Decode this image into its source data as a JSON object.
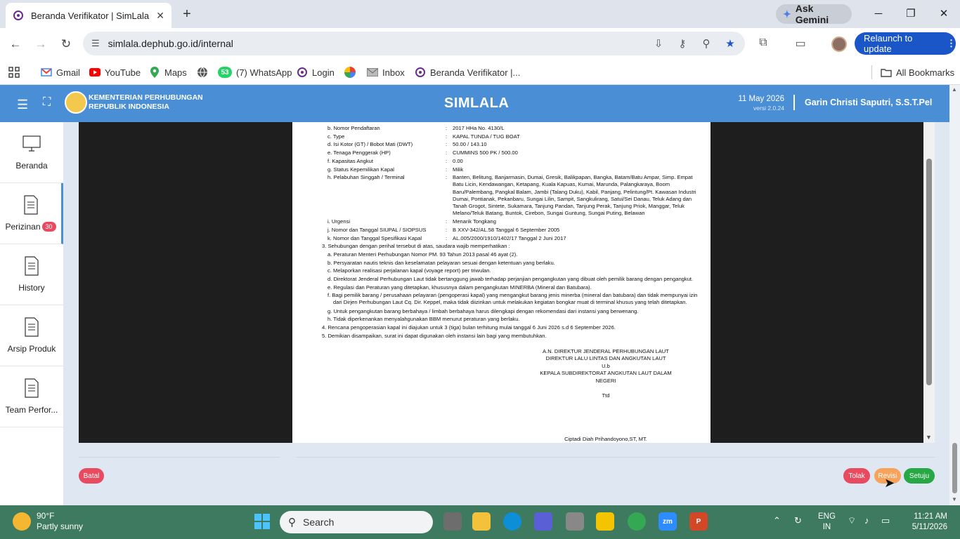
{
  "browser": {
    "tab_title": "Beranda Verifikator | SimLala",
    "new_tab": "+",
    "close_tab": "✕",
    "ask_gemini": "Ask Gemini",
    "url": "simlala.dephub.go.id/internal",
    "relaunch": "Relaunch to update",
    "bookmarks": [
      {
        "label": "Gmail",
        "color": "#ea4335"
      },
      {
        "label": "YouTube",
        "color": "#ff0000"
      },
      {
        "label": "Maps",
        "color": "#34a853"
      },
      {
        "label": "",
        "color": "#555555"
      },
      {
        "label": "(7) WhatsApp",
        "color": "#25d366",
        "badge": "53"
      },
      {
        "label": "Login",
        "color": "#6b2d8c"
      },
      {
        "label": "",
        "color": "#f4b400"
      },
      {
        "label": "Inbox",
        "color": "#888888"
      },
      {
        "label": "Beranda Verifikator |...",
        "color": "#6b2d8c"
      }
    ],
    "all_bookmarks": "All Bookmarks"
  },
  "app": {
    "ministry_line1": "KEMENTERIAN PERHUBUNGAN",
    "ministry_line2": "REPUBLIK INDONESIA",
    "name": "SIMLALA",
    "date": "11 May 2026",
    "version": "versi 2.0.24",
    "user": "Garin Christi Saputri, S.S.T.Pel",
    "accent": "#4a8fd6"
  },
  "sidebar": [
    {
      "label": "Beranda",
      "icon": "monitor-icon"
    },
    {
      "label": "Perizinan",
      "icon": "document-icon",
      "badge": "30",
      "active": true
    },
    {
      "label": "History",
      "icon": "document-icon"
    },
    {
      "label": "Arsip Produk",
      "icon": "document-icon"
    },
    {
      "label": "Team Perfor...",
      "icon": "document-icon"
    }
  ],
  "document": {
    "fields": [
      {
        "key": "b. Nomor Pendaftaran",
        "value": "2017 HHa No. 4130/L"
      },
      {
        "key": "c. Type",
        "value": "KAPAL TUNDA / TUG BOAT"
      },
      {
        "key": "d. Isi Kotor (GT) / Bobot Mati (DWT)",
        "value": "50.00  / 143.10"
      },
      {
        "key": "e. Tenaga Penggerak (HP)",
        "value": "CUMMINS 500 PK  / 500.00"
      },
      {
        "key": "f.  Kapasitas Angkut",
        "value": "0.00"
      },
      {
        "key": "g. Status Kepemilikan Kapal",
        "value": "Milik"
      },
      {
        "key": "h. Pelabuhan Singgah / Terminal",
        "value": "Banten, Belitung, Banjarmasin, Dumai, Gresik, Balikpapan, Bangka, Batam/Batu Ampar, Simp. Empat Batu Licin, Kendawangan, Ketapang, Kuala Kapuas, Kumai, Marunda, Palangkaraya, Boom Baru/Palembang, Pangkal Balam, Jambi (Talang Duku), Kabil, Panjang, Pelintung/Pt. Kawasan Industri Dumai, Pontianak, Pekanbaru, Sungai Lilin, Sampit, Sangkulirang, Satui/Sei Danau, Teluk Adang dan Tanah Grogot, Sintete, Sukamara, Tanjung Pandan, Tanjung Perak, Tanjung Priok, Manggar, Teluk Melano/Teluk Batang, Buntok, Cirebon, Sungai Guntung, Sungai Puting, Belawan"
      },
      {
        "key": "i.  Urgensi",
        "value": "Menarik Tongkang"
      },
      {
        "key": "j.  Nomor dan Tanggal SIUPAL / SIOPSUS",
        "value": "B XXV-342/AL.58  Tanggal 6 September 2005"
      },
      {
        "key": "k. Nomor dan Tanggal Spesifikasi Kapal",
        "value": "AL.005/2000/1910/1402/17  Tanggal 2 Juni 2017"
      }
    ],
    "colon": ":",
    "section3": "3. Sehubungan dengan perihal tersebut di atas, saudara wajib memperhatikan :",
    "obligations": [
      "a. Peraturan Menteri Perhubungan Nomor PM. 93 Tahun 2013 pasal 46 ayat (2).",
      "b. Persyaratan nautis teknis dan keselamatan pelayaran sesuai dengan ketentuan yang berlaku.",
      "c. Melaporkan realisasi perjalanan kapal (voyage report) per triwulan.",
      "d. Direktorat Jenderal Perhubungan Laut tidak bertanggung jawab terhadap perjanjian pengangkutan yang dibuat oleh pemilik barang dengan pengangkut.",
      "e. Regulasi dan Peraturan yang ditetapkan, khususnya dalam pengangkutan MINERBA (Mineral dan Batubara).",
      "f.  Bagi pemilik barang / perusahaan pelayaran (pengoperasi kapal) yang mengangkut barang jenis minerba (mineral dan batubara) dan tidak mempunyai izin dari Dirjen Perhubungan Laut Cq. Dir. Keppel, maka tidak diizinkan untuk melakukan kegiatan bongkar muat di terminal khusus yang telah ditetapkan.",
      "g. Untuk pengangkutan barang berbahaya / limbah berbahaya harus dilengkapi dengan rekomendasi dari instansi yang berwenang.",
      "h. Tidak diperkenankan menyalahgunakan BBM menurut peraturan yang berlaku."
    ],
    "section4": "4. Rencana pengoperasian kapal ini diajukan untuk 3 (tiga) bulan terhitung mulai tanggal 6 Juni 2026 s.d 6 September 2026.",
    "section5": "5. Demikian disampaikan,  surat ini dapat  digunakan oleh instansi lain bagi yang membutuhkan.",
    "sign_lines": [
      "A.N. DIREKTUR JENDERAL PERHUBUNGAN LAUT",
      "DIREKTUR LALU LINTAS DAN ANGKUTAN LAUT",
      "U.b",
      "KEPALA SUBDIREKTORAT ANGKUTAN LAUT DALAM",
      "NEGERI"
    ],
    "ttd": "Ttd",
    "signer": "Ciptadi Diah Prihandoyono,ST, MT."
  },
  "actions": {
    "batal": "Batal",
    "tolak": "Tolak",
    "revisi": "Revisi",
    "setuju": "Setuju",
    "color_batal": "#e84a5f",
    "color_revisi": "#f7a35c",
    "color_setuju": "#28a745"
  },
  "taskbar": {
    "temp": "90°F",
    "condition": "Partly sunny",
    "search": "Search",
    "lang1": "ENG",
    "lang2": "IN",
    "time": "11:21 AM",
    "date": "5/11/2026"
  }
}
